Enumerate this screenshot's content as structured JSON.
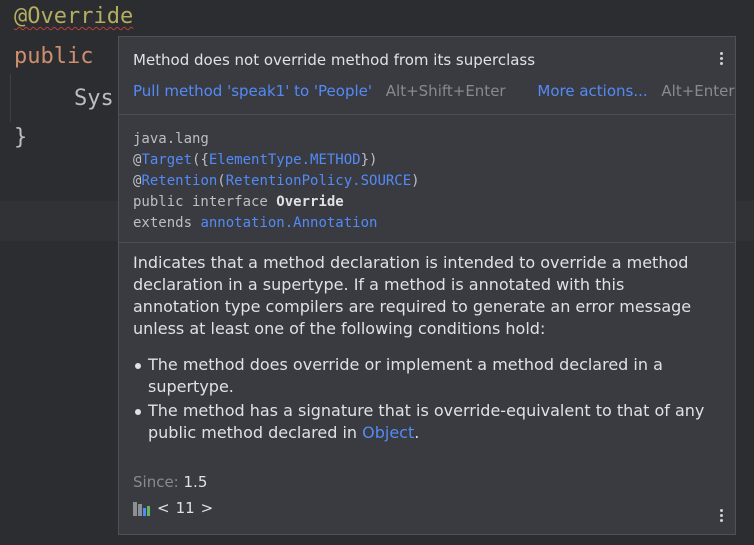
{
  "editor": {
    "line1": "@Override",
    "line2": "public",
    "line3": "Sys",
    "line4": "}"
  },
  "popup": {
    "problem": "Method does not override method from its superclass",
    "fix_action": "Pull method 'speak1' to 'People'",
    "fix_shortcut": "Alt+Shift+Enter",
    "more_actions": "More actions...",
    "more_shortcut": "Alt+Enter",
    "declaration": {
      "package": "java.lang",
      "at1": "@",
      "target": "Target",
      "target_args_open": "({",
      "element_type": "ElementType.METHOD",
      "target_args_close": "})",
      "at2": "@",
      "retention": "Retention",
      "ret_open": "(",
      "retention_policy": "RetentionPolicy.SOURCE",
      "ret_close": ")",
      "iface_prefix": "public interface ",
      "iface_name": "Override",
      "extends_kw": "extends ",
      "extends_type": "annotation.Annotation"
    },
    "doc": {
      "intro": "Indicates that a method declaration is intended to override a method declaration in a supertype. If a method is annotated with this annotation type compilers are required to generate an error message unless at least one of the following conditions hold:",
      "bullet1": "The method does override or implement a method declared in a supertype.",
      "bullet2_prefix": "The method has a signature that is override-equivalent to that of any public method declared in ",
      "bullet2_link": "Object",
      "bullet2_suffix": "."
    },
    "since_label": "Since:",
    "since_value": "1.5",
    "nav_prev": "<",
    "nav_version": "11",
    "nav_next": ">"
  },
  "icons": [
    "more-vertical-icon",
    "library-icon"
  ]
}
